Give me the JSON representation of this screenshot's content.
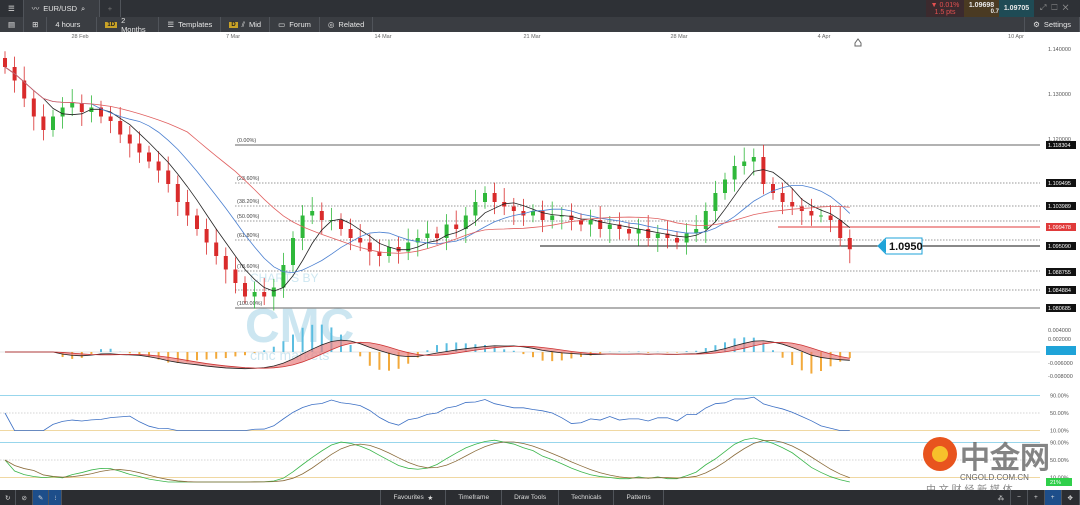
{
  "window": {
    "symbol": "EUR/USD",
    "add_tab": "+"
  },
  "toolbar": {
    "interval": "4 hours",
    "range_badge": "1D",
    "range": "2 Months",
    "templates": "Templates",
    "price_badge": "D",
    "price_type": "Mid",
    "forum": "Forum",
    "related": "Related",
    "settings": "Settings"
  },
  "quote": {
    "change_pct": "▼ 0.01%",
    "change_pips": "1.5 pts",
    "bid": "1.09698",
    "ask": "1.09705",
    "spread": "0.7"
  },
  "x_axis": {
    "labels": [
      "28 Feb",
      "7 Mar",
      "14 Mar",
      "21 Mar",
      "28 Mar",
      "4 Apr",
      "10 Apr"
    ]
  },
  "price_axis": {
    "ticks": [
      "1.140000",
      "1.130000",
      "1.120000",
      "1.090000"
    ]
  },
  "fibonacci": {
    "levels": [
      "(0.00%)",
      "(23.60%)",
      "(38.20%)",
      "(50.00%)",
      "(61.80%)",
      "(78.60%)",
      "(100.00%)"
    ]
  },
  "price_labels": [
    {
      "value": "1.118304",
      "color": "#111111"
    },
    {
      "value": "1.109495",
      "color": "#111111"
    },
    {
      "value": "1.103989",
      "color": "#111111"
    },
    {
      "value": "1.099478",
      "color": "#e03a3a"
    },
    {
      "value": "1.095090",
      "color": "#111111"
    },
    {
      "value": "1.088755",
      "color": "#111111"
    },
    {
      "value": "1.084884",
      "color": "#111111"
    },
    {
      "value": "1.080685",
      "color": "#111111"
    }
  ],
  "annotation": {
    "text": "1.0950",
    "color": "#1fa3d8"
  },
  "macd_axis": {
    "ticks": [
      "0.004000",
      "0.002000",
      "-0.0012",
      "-0.006000",
      "-0.008000"
    ]
  },
  "osc1_axis": {
    "ticks": [
      "90.00%",
      "50.00%",
      "10.00%"
    ]
  },
  "osc2_axis": {
    "ticks": [
      "90.00%",
      "50.00%",
      "10.00%"
    ],
    "current": "21%"
  },
  "watermark": {
    "brand": "CMC",
    "sub": "cmc markets",
    "powered": "CHARTS BY"
  },
  "cngold": {
    "name": "中金网",
    "url": "CNGOLD.COM.CN",
    "slogan": "中 文 财 经 新 媒 体"
  },
  "bottom": {
    "tabs": [
      "Favourites",
      "Timeframe",
      "Draw Tools",
      "Technicals",
      "Patterns"
    ]
  },
  "colors": {
    "up": "#2fb83a",
    "down": "#d92b2b",
    "sma_fast": "#222222",
    "sma_mid": "#4a7fd0",
    "sma_slow": "#e06060"
  },
  "chart_data": {
    "type": "candlestick",
    "series": [
      {
        "closes": [
          1.136,
          1.133,
          1.129,
          1.125,
          1.122,
          1.125,
          1.127,
          1.128,
          1.126,
          1.127,
          1.125,
          1.124,
          1.121,
          1.119,
          1.117,
          1.115,
          1.113,
          1.11,
          1.106,
          1.103,
          1.1,
          1.097,
          1.094,
          1.091,
          1.088,
          1.085,
          1.086,
          1.085,
          1.087,
          1.092,
          1.098,
          1.103,
          1.104,
          1.102,
          1.102,
          1.1,
          1.098,
          1.097,
          1.095,
          1.094,
          1.096,
          1.095,
          1.097,
          1.098,
          1.099,
          1.098,
          1.101,
          1.1,
          1.103,
          1.106,
          1.108,
          1.106,
          1.105,
          1.104,
          1.103,
          1.104,
          1.102,
          1.103,
          1.103,
          1.102,
          1.101,
          1.102,
          1.1,
          1.101,
          1.1,
          1.099,
          1.1,
          1.098,
          1.099,
          1.098,
          1.097,
          1.099,
          1.1,
          1.104,
          1.108,
          1.111,
          1.114,
          1.115,
          1.116,
          1.11,
          1.108,
          1.106,
          1.105,
          1.104,
          1.103,
          1.103,
          1.102,
          1.098,
          1.0955
        ]
      }
    ],
    "ylim": [
      1.08,
      1.14
    ]
  }
}
